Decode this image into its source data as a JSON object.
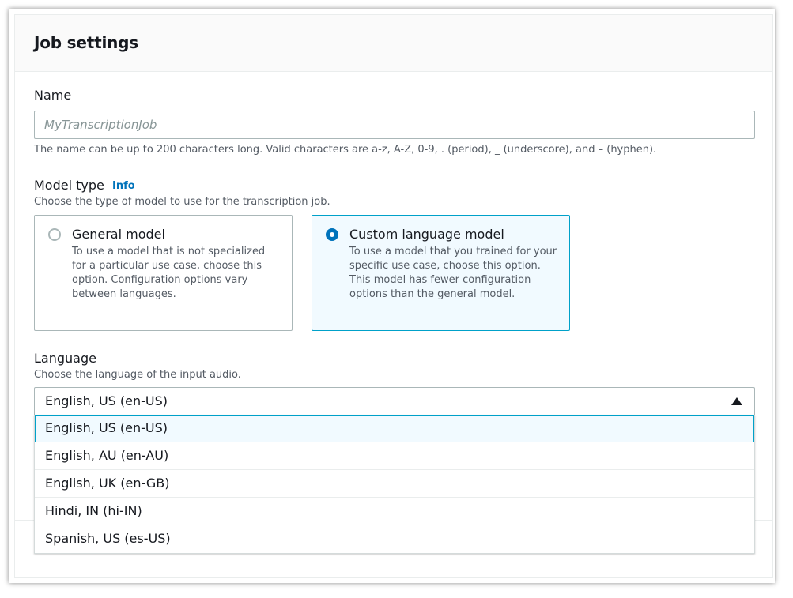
{
  "panel": {
    "title": "Job settings"
  },
  "name_field": {
    "label": "Name",
    "placeholder": "MyTranscriptionJob",
    "value": "",
    "description": "The name can be up to 200 characters long. Valid characters are a-z, A-Z, 0-9, . (period), _ (underscore), and – (hyphen)."
  },
  "model_type": {
    "label": "Model type",
    "info_link": "Info",
    "description": "Choose the type of model to use for the transcription job.",
    "options": [
      {
        "title": "General model",
        "description": "To use a model that is not specialized for a particular use case, choose this option. Configuration options vary between languages.",
        "selected": false
      },
      {
        "title": "Custom language model",
        "description": "To use a model that you trained for your specific use case, choose this option. This model has fewer configuration options than the general model.",
        "selected": true
      }
    ]
  },
  "language": {
    "label": "Language",
    "description": "Choose the language of the input audio.",
    "selected": "English, US (en-US)",
    "expanded": true,
    "options": [
      "English, US (en-US)",
      "English, AU (en-AU)",
      "English, UK (en-GB)",
      "Hindi, IN (hi-IN)",
      "Spanish, US (es-US)"
    ],
    "highlighted_index": 0
  },
  "colors": {
    "accent": "#0073bb",
    "selected_border": "#00a1c9",
    "selected_bg": "#f1faff",
    "border": "#aab7b8"
  }
}
